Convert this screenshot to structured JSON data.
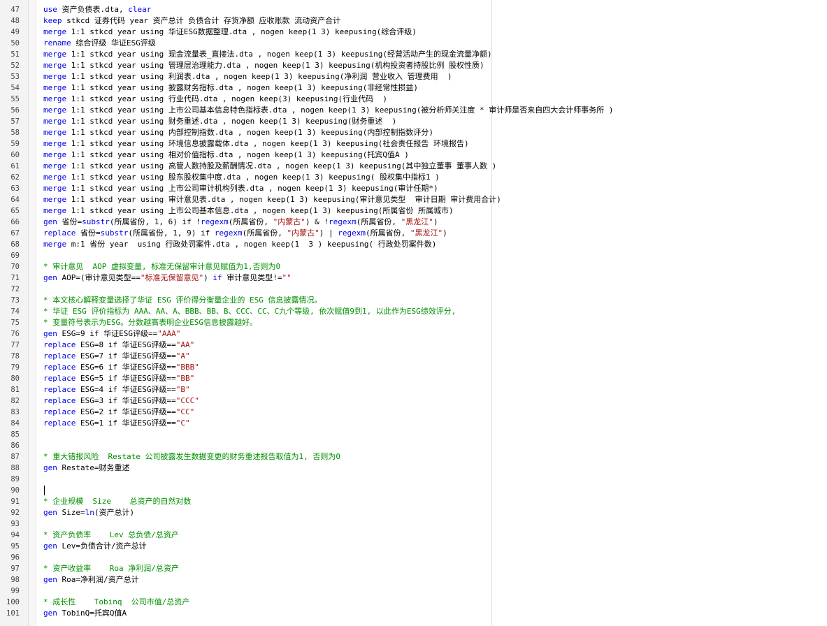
{
  "editor": {
    "lines": [
      {
        "n": "47",
        "segs": [
          {
            "t": "kw",
            "v": "use"
          },
          {
            "t": "",
            "v": " 资产负债表.dta, "
          },
          {
            "t": "kw",
            "v": "clear"
          }
        ]
      },
      {
        "n": "48",
        "segs": [
          {
            "t": "kw",
            "v": "keep"
          },
          {
            "t": "",
            "v": " stkcd 证券代码 year 资产总计 负债合计 存货净额 应收账款 流动资产合计"
          }
        ]
      },
      {
        "n": "49",
        "segs": [
          {
            "t": "kw",
            "v": "merge"
          },
          {
            "t": "",
            "v": " 1:1 stkcd year using 华证ESG数据整理.dta , nogen keep(1 3) keepusing(综合评级)"
          }
        ]
      },
      {
        "n": "50",
        "segs": [
          {
            "t": "kw",
            "v": "rename"
          },
          {
            "t": "",
            "v": " 综合评级 华证ESG评级"
          }
        ]
      },
      {
        "n": "51",
        "segs": [
          {
            "t": "kw",
            "v": "merge"
          },
          {
            "t": "",
            "v": " 1:1 stkcd year using 现金流量表_直接法.dta , nogen keep(1 3) keepusing(经营活动产生的现金流量净额)"
          }
        ]
      },
      {
        "n": "52",
        "segs": [
          {
            "t": "kw",
            "v": "merge"
          },
          {
            "t": "",
            "v": " 1:1 stkcd year using 管理层治理能力.dta , nogen keep(1 3) keepusing(机构投资者持股比例 股权性质)"
          }
        ]
      },
      {
        "n": "53",
        "segs": [
          {
            "t": "kw",
            "v": "merge"
          },
          {
            "t": "",
            "v": " 1:1 stkcd year using 利润表.dta , nogen keep(1 3) keepusing(净利润 营业收入 管理费用  )"
          }
        ]
      },
      {
        "n": "54",
        "segs": [
          {
            "t": "kw",
            "v": "merge"
          },
          {
            "t": "",
            "v": " 1:1 stkcd year using 披露财务指标.dta , nogen keep(1 3) keepusing(非经常性损益)"
          }
        ]
      },
      {
        "n": "55",
        "segs": [
          {
            "t": "kw",
            "v": "merge"
          },
          {
            "t": "",
            "v": " 1:1 stkcd year using 行业代码.dta , nogen keep(3) keepusing(行业代码  )"
          }
        ]
      },
      {
        "n": "56",
        "segs": [
          {
            "t": "kw",
            "v": "merge"
          },
          {
            "t": "",
            "v": " 1:1 stkcd year using 上市公司基本信息特色指标表.dta , nogen keep(1 3) keepusing(被分析师关注度 * 审计师是否来自四大会计师事务所 )"
          }
        ]
      },
      {
        "n": "57",
        "segs": [
          {
            "t": "kw",
            "v": "merge"
          },
          {
            "t": "",
            "v": " 1:1 stkcd year using 财务重述.dta , nogen keep(1 3) keepusing(财务重述  )"
          }
        ]
      },
      {
        "n": "58",
        "segs": [
          {
            "t": "kw",
            "v": "merge"
          },
          {
            "t": "",
            "v": " 1:1 stkcd year using 内部控制指数.dta , nogen keep(1 3) keepusing(内部控制指数评分)"
          }
        ]
      },
      {
        "n": "59",
        "segs": [
          {
            "t": "kw",
            "v": "merge"
          },
          {
            "t": "",
            "v": " 1:1 stkcd year using 环境信息披露载体.dta , nogen keep(1 3) keepusing(社会责任报告 环境报告)"
          }
        ]
      },
      {
        "n": "60",
        "segs": [
          {
            "t": "kw",
            "v": "merge"
          },
          {
            "t": "",
            "v": " 1:1 stkcd year using 相对价值指标.dta , nogen keep(1 3) keepusing(托宾Q值A )"
          }
        ]
      },
      {
        "n": "61",
        "segs": [
          {
            "t": "kw",
            "v": "merge"
          },
          {
            "t": "",
            "v": " 1:1 stkcd year using 高管人数持股及薪酬情况.dta , nogen keep(1 3) keepusing(其中独立董事 董事人数 )"
          }
        ]
      },
      {
        "n": "62",
        "segs": [
          {
            "t": "kw",
            "v": "merge"
          },
          {
            "t": "",
            "v": " 1:1 stkcd year using 股东股权集中度.dta , nogen keep(1 3) keepusing( 股权集中指标1 )"
          }
        ]
      },
      {
        "n": "63",
        "segs": [
          {
            "t": "kw",
            "v": "merge"
          },
          {
            "t": "",
            "v": " 1:1 stkcd year using 上市公司审计机构列表.dta , nogen keep(1 3) keepusing(审计任期*)"
          }
        ]
      },
      {
        "n": "64",
        "segs": [
          {
            "t": "kw",
            "v": "merge"
          },
          {
            "t": "",
            "v": " 1:1 stkcd year using 审计意见表.dta , nogen keep(1 3) keepusing(审计意见类型  审计日期 审计费用合计)"
          }
        ]
      },
      {
        "n": "65",
        "segs": [
          {
            "t": "kw",
            "v": "merge"
          },
          {
            "t": "",
            "v": " 1:1 stkcd year using 上市公司基本信息.dta , nogen keep(1 3) keepusing(所属省份 所属城市)"
          }
        ]
      },
      {
        "n": "66",
        "segs": [
          {
            "t": "kw",
            "v": "gen"
          },
          {
            "t": "",
            "v": " 省份="
          },
          {
            "t": "kw",
            "v": "substr"
          },
          {
            "t": "",
            "v": "(所属省份, 1, 6) if !"
          },
          {
            "t": "kw",
            "v": "regexm"
          },
          {
            "t": "",
            "v": "(所属省份, "
          },
          {
            "t": "st",
            "v": "\"内蒙古\""
          },
          {
            "t": "",
            "v": ") & !"
          },
          {
            "t": "kw",
            "v": "regexm"
          },
          {
            "t": "",
            "v": "(所属省份, "
          },
          {
            "t": "st",
            "v": "\"黑龙江\""
          },
          {
            "t": "",
            "v": ")"
          }
        ]
      },
      {
        "n": "67",
        "segs": [
          {
            "t": "kw",
            "v": "replace"
          },
          {
            "t": "",
            "v": " 省份="
          },
          {
            "t": "kw",
            "v": "substr"
          },
          {
            "t": "",
            "v": "(所属省份, 1, 9) if "
          },
          {
            "t": "kw",
            "v": "regexm"
          },
          {
            "t": "",
            "v": "(所属省份, "
          },
          {
            "t": "st",
            "v": "\"内蒙古\""
          },
          {
            "t": "",
            "v": ") | "
          },
          {
            "t": "kw",
            "v": "regexm"
          },
          {
            "t": "",
            "v": "(所属省份, "
          },
          {
            "t": "st",
            "v": "\"黑龙江\""
          },
          {
            "t": "",
            "v": ")"
          }
        ]
      },
      {
        "n": "68",
        "segs": [
          {
            "t": "kw",
            "v": "merge"
          },
          {
            "t": "",
            "v": " m:1 省份 year  using 行政处罚案件.dta , nogen keep(1  3 ) keepusing( 行政处罚案件数)"
          }
        ]
      },
      {
        "n": "69",
        "segs": []
      },
      {
        "n": "70",
        "segs": [
          {
            "t": "cm",
            "v": "* 审计意见  AOP 虚拟变量, 标准无保留审计意见赋值为1,否则为0"
          }
        ]
      },
      {
        "n": "71",
        "segs": [
          {
            "t": "kw",
            "v": "gen"
          },
          {
            "t": "",
            "v": " AOP=(审计意见类型=="
          },
          {
            "t": "st",
            "v": "\"标准无保留意见\""
          },
          {
            "t": "",
            "v": ") "
          },
          {
            "t": "kw",
            "v": "if"
          },
          {
            "t": "",
            "v": " 审计意见类型!="
          },
          {
            "t": "st",
            "v": "\"\""
          }
        ]
      },
      {
        "n": "72",
        "segs": []
      },
      {
        "n": "73",
        "segs": [
          {
            "t": "cm",
            "v": "* 本文核心解释变量选择了华证 ESG 评价得分衡量企业的 ESG 信息披露情况。"
          }
        ]
      },
      {
        "n": "74",
        "segs": [
          {
            "t": "cm",
            "v": "* 华证 ESG 评价指标为 AAA、AA、A、BBB、BB、B、CCC、CC、C九个等级, 依次赋值9到1, 以此作为ESG绩效评分,"
          }
        ]
      },
      {
        "n": "75",
        "segs": [
          {
            "t": "cm",
            "v": "* 变量符号表示为ESG。分数越高表明企业ESG信息披露越好。"
          }
        ]
      },
      {
        "n": "76",
        "segs": [
          {
            "t": "kw",
            "v": "gen"
          },
          {
            "t": "",
            "v": " ESG=9 if 华证ESG评级=="
          },
          {
            "t": "st",
            "v": "\"AAA\""
          }
        ]
      },
      {
        "n": "77",
        "segs": [
          {
            "t": "kw",
            "v": "replace"
          },
          {
            "t": "",
            "v": " ESG=8 if 华证ESG评级=="
          },
          {
            "t": "st",
            "v": "\"AA\""
          }
        ]
      },
      {
        "n": "78",
        "segs": [
          {
            "t": "kw",
            "v": "replace"
          },
          {
            "t": "",
            "v": " ESG=7 if 华证ESG评级=="
          },
          {
            "t": "st",
            "v": "\"A\""
          }
        ]
      },
      {
        "n": "79",
        "segs": [
          {
            "t": "kw",
            "v": "replace"
          },
          {
            "t": "",
            "v": " ESG=6 if 华证ESG评级=="
          },
          {
            "t": "st",
            "v": "\"BBB\""
          }
        ]
      },
      {
        "n": "80",
        "segs": [
          {
            "t": "kw",
            "v": "replace"
          },
          {
            "t": "",
            "v": " ESG=5 if 华证ESG评级=="
          },
          {
            "t": "st",
            "v": "\"BB\""
          }
        ]
      },
      {
        "n": "81",
        "segs": [
          {
            "t": "kw",
            "v": "replace"
          },
          {
            "t": "",
            "v": " ESG=4 if 华证ESG评级=="
          },
          {
            "t": "st",
            "v": "\"B\""
          }
        ]
      },
      {
        "n": "82",
        "segs": [
          {
            "t": "kw",
            "v": "replace"
          },
          {
            "t": "",
            "v": " ESG=3 if 华证ESG评级=="
          },
          {
            "t": "st",
            "v": "\"CCC\""
          }
        ]
      },
      {
        "n": "83",
        "segs": [
          {
            "t": "kw",
            "v": "replace"
          },
          {
            "t": "",
            "v": " ESG=2 if 华证ESG评级=="
          },
          {
            "t": "st",
            "v": "\"CC\""
          }
        ]
      },
      {
        "n": "84",
        "segs": [
          {
            "t": "kw",
            "v": "replace"
          },
          {
            "t": "",
            "v": " ESG=1 if 华证ESG评级=="
          },
          {
            "t": "st",
            "v": "\"C\""
          }
        ]
      },
      {
        "n": "85",
        "segs": []
      },
      {
        "n": "86",
        "segs": []
      },
      {
        "n": "87",
        "segs": [
          {
            "t": "cm",
            "v": "* 重大错报风险  Restate 公司披露发生数据变更的财务重述报告取值为1, 否则为0"
          }
        ]
      },
      {
        "n": "88",
        "segs": [
          {
            "t": "kw",
            "v": "gen"
          },
          {
            "t": "",
            "v": " Restate=财务重述"
          }
        ]
      },
      {
        "n": "89",
        "segs": []
      },
      {
        "n": "90",
        "segs": []
      },
      {
        "n": "91",
        "segs": [
          {
            "t": "cm",
            "v": "* 企业规模  Size    总资产的自然对数"
          }
        ]
      },
      {
        "n": "92",
        "segs": [
          {
            "t": "kw",
            "v": "gen"
          },
          {
            "t": "",
            "v": " Size="
          },
          {
            "t": "kw",
            "v": "ln"
          },
          {
            "t": "",
            "v": "(资产总计)"
          }
        ]
      },
      {
        "n": "93",
        "segs": []
      },
      {
        "n": "94",
        "segs": [
          {
            "t": "cm",
            "v": "* 资产负债率    Lev 总负债/总资产"
          }
        ]
      },
      {
        "n": "95",
        "segs": [
          {
            "t": "kw",
            "v": "gen"
          },
          {
            "t": "",
            "v": " Lev=负债合计/资产总计"
          }
        ]
      },
      {
        "n": "96",
        "segs": []
      },
      {
        "n": "97",
        "segs": [
          {
            "t": "cm",
            "v": "* 资产收益率    Roa 净利润/总资产"
          }
        ]
      },
      {
        "n": "98",
        "segs": [
          {
            "t": "kw",
            "v": "gen"
          },
          {
            "t": "",
            "v": " Roa=净利润/资产总计"
          }
        ]
      },
      {
        "n": "99",
        "segs": []
      },
      {
        "n": "100",
        "segs": [
          {
            "t": "cm",
            "v": "* 成长性    Tobinq  公司市值/总资产"
          }
        ]
      },
      {
        "n": "101",
        "segs": [
          {
            "t": "kw",
            "v": "gen"
          },
          {
            "t": "",
            "v": " TobinQ=托宾Q值A"
          }
        ]
      }
    ],
    "caret_line": "90"
  }
}
